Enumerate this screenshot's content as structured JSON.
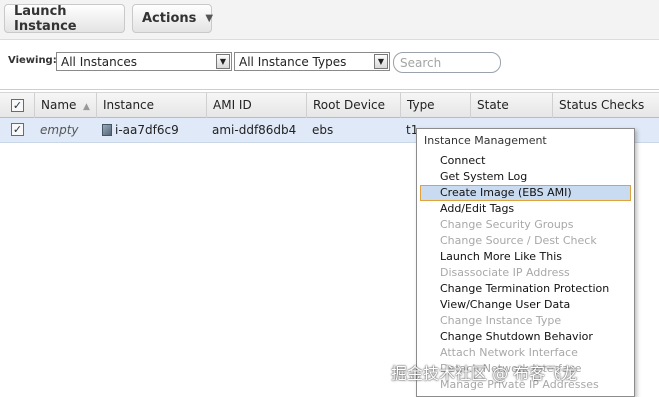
{
  "toolbar": {
    "launch_label": "Launch Instance",
    "actions_label": "Actions"
  },
  "filter": {
    "viewing_label": "Viewing:",
    "instances_select": "All Instances",
    "types_select": "All Instance Types",
    "search_placeholder": "Search"
  },
  "table": {
    "columns": [
      "Name",
      "Instance",
      "AMI ID",
      "Root Device",
      "Type",
      "State",
      "Status Checks"
    ],
    "rows": [
      {
        "checked": true,
        "name": "empty",
        "instance": "i-aa7df6c9",
        "ami_id": "ami-ddf86db4",
        "root_device": "ebs",
        "type": "t1",
        "state": "",
        "status_checks": ""
      }
    ]
  },
  "menu": {
    "header": "Instance Management",
    "items": [
      {
        "label": "Connect",
        "enabled": true
      },
      {
        "label": "Get System Log",
        "enabled": true
      },
      {
        "label": "Create Image (EBS AMI)",
        "enabled": true,
        "highlighted": true
      },
      {
        "label": "Add/Edit Tags",
        "enabled": true
      },
      {
        "label": "Change Security Groups",
        "enabled": false
      },
      {
        "label": "Change Source / Dest Check",
        "enabled": false
      },
      {
        "label": "Launch More Like This",
        "enabled": true
      },
      {
        "label": "Disassociate IP Address",
        "enabled": false
      },
      {
        "label": "Change Termination Protection",
        "enabled": true
      },
      {
        "label": "View/Change User Data",
        "enabled": true
      },
      {
        "label": "Change Instance Type",
        "enabled": false
      },
      {
        "label": "Change Shutdown Behavior",
        "enabled": true
      },
      {
        "label": "Attach Network Interface",
        "enabled": false
      },
      {
        "label": "Detach Network Interface",
        "enabled": false
      },
      {
        "label": "Manage Private IP Addresses",
        "enabled": false
      }
    ]
  },
  "watermark": "掘金技术社区 @ 布客飞龙",
  "colors": {
    "row_selected": "#dfe9f7",
    "menu_highlight": "#c9dbf1",
    "menu_highlight_border": "#e0a23a",
    "disabled_text": "#a8a8a8"
  }
}
